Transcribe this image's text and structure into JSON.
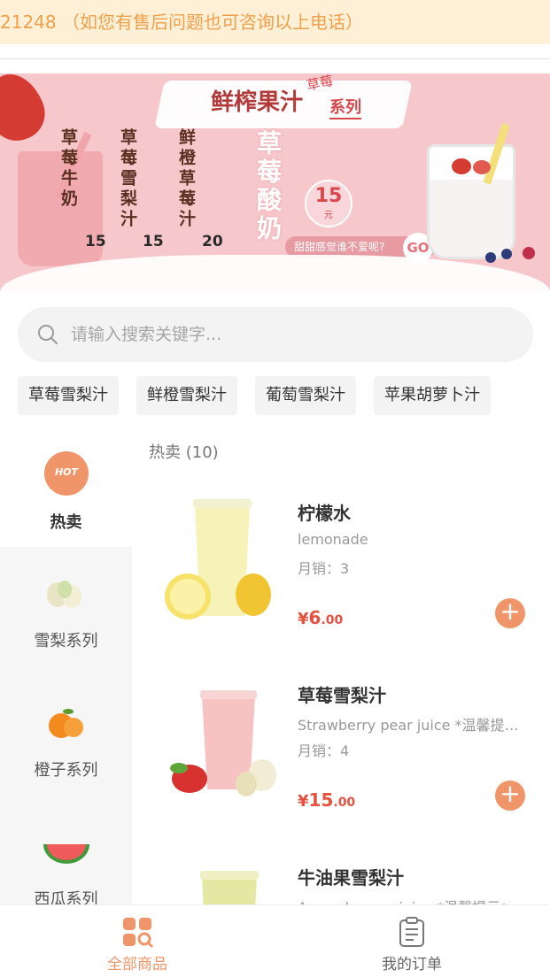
{
  "notice": {
    "text": "21248 （如您有售后问题也可咨询以上电话）"
  },
  "banner": {
    "title": "鲜榨果汁",
    "tag": "草莓",
    "series": "系列",
    "drinks": [
      {
        "name": "草莓牛奶",
        "price": "15"
      },
      {
        "name": "草莓雪梨汁",
        "price": "15"
      },
      {
        "name": "鲜橙草莓汁",
        "price": "20"
      }
    ],
    "feature_name": "草莓酸奶",
    "feature_price": "15",
    "feature_unit": "元",
    "slogan": "甜甜感觉谁不爱呢?",
    "go": "GO"
  },
  "search": {
    "placeholder": "请输入搜索关键字..."
  },
  "quick_tags": [
    "草莓雪梨汁",
    "鲜橙雪梨汁",
    "葡萄雪梨汁",
    "苹果胡萝卜汁"
  ],
  "sidebar": {
    "hot_badge": "HOT",
    "items": [
      {
        "label": "热卖",
        "icon": "flame-icon"
      },
      {
        "label": "雪梨系列",
        "icon": "pear-icon"
      },
      {
        "label": "橙子系列",
        "icon": "orange-icon"
      },
      {
        "label": "西瓜系列",
        "icon": "watermelon-icon"
      }
    ]
  },
  "category_header": "热卖 (10)",
  "products": [
    {
      "name": "柠檬水",
      "desc": "lemonade",
      "sales": "月销：3",
      "currency": "¥",
      "price_int": "6",
      "price_dec": ".00"
    },
    {
      "name": "草莓雪梨汁",
      "desc": "Strawberry pear juice *温馨提示：",
      "sales": "月销：4",
      "currency": "¥",
      "price_int": "15",
      "price_dec": ".00"
    },
    {
      "name": "牛油果雪梨汁",
      "desc": "Avocado pear juice *温馨提示：",
      "sales": "",
      "currency": "",
      "price_int": "",
      "price_dec": ""
    }
  ],
  "tabbar": {
    "tabs": [
      {
        "label": "全部商品",
        "icon": "grid-search-icon",
        "active": true
      },
      {
        "label": "我的订单",
        "icon": "clipboard-icon",
        "active": false
      }
    ]
  },
  "colors": {
    "accent": "#f0956a",
    "price": "#e4513f",
    "notice_bg": "#fdf0d6",
    "notice_text": "#f0a04a",
    "banner_bg": "#f6c7cb"
  }
}
